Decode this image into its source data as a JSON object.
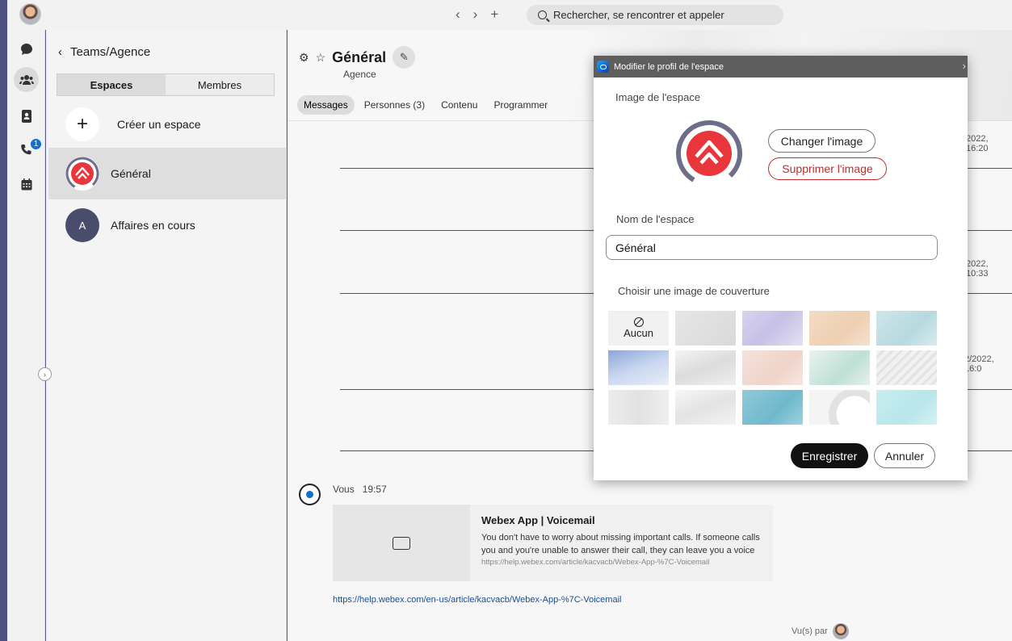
{
  "titlebar": {
    "nav_back": "‹",
    "nav_forward": "›",
    "nav_add": "+",
    "search_placeholder": "Rechercher, se rencontrer et appeler"
  },
  "rail": {
    "icons": [
      "chat-icon",
      "teams-icon",
      "contacts-icon",
      "phone-icon",
      "calendar-icon"
    ],
    "call_badge": "1"
  },
  "sidebar": {
    "breadcrumb": "Teams/Agence",
    "segments": [
      "Espaces",
      "Membres"
    ],
    "create_label": "Créer un espace",
    "spaces": [
      {
        "name": "Général",
        "avatar": "logo"
      },
      {
        "name": "Affaires en cours",
        "avatar_letter": "A"
      }
    ]
  },
  "main": {
    "title": "Général",
    "subtitle": "Agence",
    "tabs": [
      "Messages",
      "Personnes (3)",
      "Contenu",
      "Programmer"
    ],
    "timestamps": [
      "2022, 16:20",
      "2022, 10:33",
      "2/2022, 16:0"
    ],
    "message": {
      "sender": "Vous",
      "time": "19:57",
      "card_title": "Webex App | Voicemail",
      "card_desc": "You don't have to worry about missing important calls. If someone calls you and you're unable to answer their call, they can leave you a voice",
      "card_url": "https://help.webex.com/article/kacvacb/Webex-App-%7C-Voicemail",
      "link": "https://help.webex.com/en-us/article/kacvacb/Webex-App-%7C-Voicemail"
    },
    "read_by": "Vu(s) par"
  },
  "modal": {
    "title": "Modifier le profil de l'espace",
    "image_label": "Image de l'espace",
    "change_image": "Changer l'image",
    "remove_image": "Supprimer l'image",
    "name_label": "Nom de l'espace",
    "name_value": "Général",
    "cover_label": "Choisir une image de couverture",
    "cover_none": "Aucun",
    "save": "Enregistrer",
    "cancel": "Annuler"
  },
  "colors": {
    "accent_red": "#e8363b",
    "badge_blue": "#1170cf",
    "frame_purple": "#5b5c8e"
  }
}
